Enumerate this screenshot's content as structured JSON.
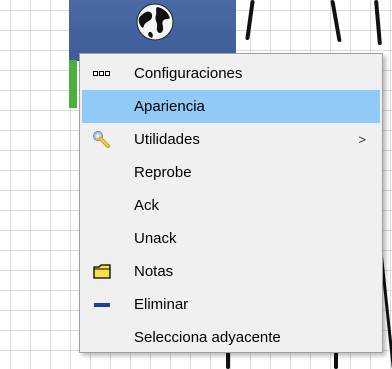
{
  "context_menu": {
    "items": [
      {
        "label": "Configuraciones",
        "icon": "dots-icon"
      },
      {
        "label": "Apariencia",
        "highlighted": true
      },
      {
        "label": "Utilidades",
        "icon": "wrench-icon",
        "submenu_arrow": ">"
      },
      {
        "label": "Reprobe"
      },
      {
        "label": "Ack"
      },
      {
        "label": "Unack"
      },
      {
        "label": "Notas",
        "icon": "note-icon"
      },
      {
        "label": "Eliminar",
        "icon": "delete-icon"
      },
      {
        "label": "Selecciona adyacente"
      }
    ]
  },
  "colors": {
    "node_header": "#3f5d98",
    "node_status": "#4caf3f",
    "menu_highlight": "#91c9f7",
    "menu_background": "#f0f0f0"
  }
}
